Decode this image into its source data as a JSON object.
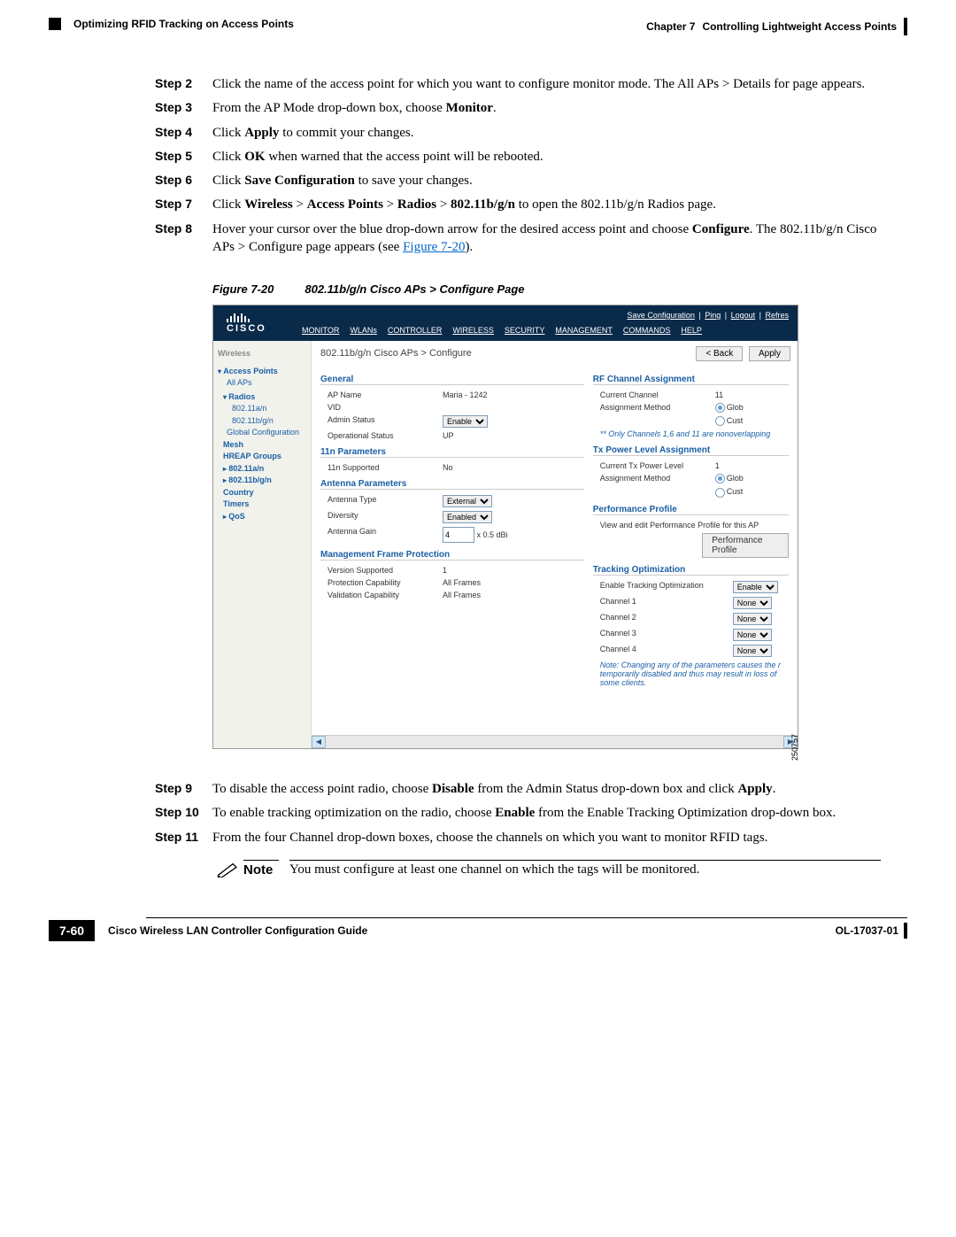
{
  "header": {
    "section": "Optimizing RFID Tracking on Access Points",
    "chapter_label": "Chapter 7",
    "chapter_title": "Controlling Lightweight Access Points"
  },
  "steps": {
    "s2": {
      "label": "Step 2",
      "pre": "Click the name of the access point for which you want to configure monitor mode. The All APs > Details for page appears."
    },
    "s3": {
      "label": "Step 3",
      "pre": "From the AP Mode drop-down box, choose ",
      "b1": "Monitor",
      "post": "."
    },
    "s4": {
      "label": "Step 4",
      "pre": "Click ",
      "b1": "Apply",
      "post": " to commit your changes."
    },
    "s5": {
      "label": "Step 5",
      "pre": "Click ",
      "b1": "OK",
      "post": " when warned that the access point will be rebooted."
    },
    "s6": {
      "label": "Step 6",
      "pre": "Click ",
      "b1": "Save Configuration",
      "post": " to save your changes."
    },
    "s7": {
      "label": "Step 7",
      "pre": "Click ",
      "b1": "Wireless",
      "m1": " > ",
      "b2": "Access Points",
      "m2": " > ",
      "b3": "Radios",
      "m3": " > ",
      "b4": "802.11b/g/n",
      "post": " to open the 802.11b/g/n Radios page."
    },
    "s8": {
      "label": "Step 8",
      "l1": "Hover your cursor over the blue drop-down arrow for the desired access point and choose ",
      "b1": "Configure",
      "l1b": ". The 802.11b/g/n Cisco APs > Configure page appears (see ",
      "link": "Figure 7-20",
      "l1c": ")."
    },
    "s9": {
      "label": "Step 9",
      "pre": "To disable the access point radio, choose ",
      "b1": "Disable",
      "mid": " from the Admin Status drop-down box and click ",
      "b2": "Apply",
      "post": "."
    },
    "s10": {
      "label": "Step 10",
      "pre": "To enable tracking optimization on the radio, choose ",
      "b1": "Enable",
      "post": " from the Enable Tracking Optimization drop-down box."
    },
    "s11": {
      "label": "Step 11",
      "text": "From the four Channel drop-down boxes, choose the channels on which you want to monitor RFID tags."
    }
  },
  "figure": {
    "num": "Figure 7-20",
    "title": "802.11b/g/n Cisco APs > Configure Page"
  },
  "cisco": {
    "logo": "CISCO",
    "top_actions": {
      "a1": "Save Configuration",
      "a2": "Ping",
      "a3": "Logout",
      "a4": "Refres"
    },
    "menu": {
      "m1": "MONITOR",
      "m2": "WLANs",
      "m3": "CONTROLLER",
      "m4": "WIRELESS",
      "m5": "SECURITY",
      "m6": "MANAGEMENT",
      "m7": "COMMANDS",
      "m8": "HELP"
    },
    "sidebar": {
      "title": "Wireless",
      "ap": "Access Points",
      "allaps": "All APs",
      "radios": "Radios",
      "r1": "802.11a/n",
      "r2": "802.11b/g/n",
      "gc": "Global Configuration",
      "mesh": "Mesh",
      "hreap": "HREAP Groups",
      "an": "802.11a/n",
      "bgn": "802.11b/g/n",
      "country": "Country",
      "timers": "Timers",
      "qos": "QoS"
    },
    "breadcrumb": "802.11b/g/n Cisco APs > Configure",
    "btn_back": "< Back",
    "btn_apply": "Apply",
    "general": {
      "hdr": "General",
      "apname_k": "AP Name",
      "apname_v": "Maria - 1242",
      "vid_k": "VID",
      "admin_k": "Admin Status",
      "admin_v": "Enable",
      "op_k": "Operational Status",
      "op_v": "UP"
    },
    "n11": {
      "hdr": "11n Parameters",
      "sup_k": "11n Supported",
      "sup_v": "No"
    },
    "antenna": {
      "hdr": "Antenna Parameters",
      "type_k": "Antenna Type",
      "type_v": "External",
      "div_k": "Diversity",
      "div_v": "Enabled",
      "gain_k": "Antenna Gain",
      "gain_v": "4",
      "gain_unit": "x 0.5 dBi"
    },
    "mfp": {
      "hdr": "Management Frame Protection",
      "vs_k": "Version Supported",
      "vs_v": "1",
      "pc_k": "Protection Capability",
      "pc_v": "All Frames",
      "vc_k": "Validation Capability",
      "vc_v": "All Frames"
    },
    "rf": {
      "hdr": "RF Channel Assignment",
      "cc_k": "Current Channel",
      "cc_v": "11",
      "am_k": "Assignment Method",
      "am_v1": "Glob",
      "am_v2": "Cust",
      "note": "** Only Channels 1,6 and 11 are nonoverlapping"
    },
    "tx": {
      "hdr": "Tx Power Level Assignment",
      "cl_k": "Current Tx Power Level",
      "cl_v": "1",
      "am_k": "Assignment Method",
      "am_v1": "Glob",
      "am_v2": "Cust"
    },
    "perf": {
      "hdr": "Performance Profile",
      "desc": "View and edit Performance Profile for this AP",
      "btn": "Performance Profile"
    },
    "track": {
      "hdr": "Tracking Optimization",
      "en_k": "Enable Tracking Optimization",
      "en_v": "Enable",
      "c1_k": "Channel 1",
      "c2_k": "Channel 2",
      "c3_k": "Channel 3",
      "c4_k": "Channel 4",
      "none": "None",
      "note": "Note: Changing any of the parameters causes the r\ntemporarily disabled and thus may result in loss of\nsome clients."
    },
    "img_id": "250757"
  },
  "note": {
    "label": "Note",
    "text": "You must configure at least one channel on which the tags will be monitored."
  },
  "footer": {
    "guide": "Cisco Wireless LAN Controller Configuration Guide",
    "pagenum": "7-60",
    "docid": "OL-17037-01"
  }
}
